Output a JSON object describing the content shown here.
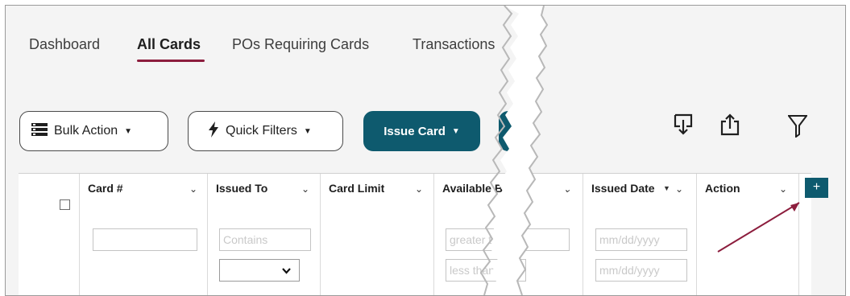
{
  "tabs": [
    {
      "label": "Dashboard",
      "active": false
    },
    {
      "label": "All Cards",
      "active": true
    },
    {
      "label": "POs Requiring Cards",
      "active": false
    },
    {
      "label": "Transactions",
      "active": false
    }
  ],
  "toolbar": {
    "bulk_action": "Bulk Action",
    "quick_filters": "Quick Filters",
    "issue_card": "Issue Card",
    "icons": [
      "download-icon",
      "share-icon",
      "filter-icon"
    ]
  },
  "grid": {
    "columns": [
      {
        "label": "Card #"
      },
      {
        "label": "Issued To"
      },
      {
        "label": "Card Limit"
      },
      {
        "label": "Available Bal"
      },
      {
        "label": "Issued Date"
      },
      {
        "label": "Action"
      }
    ],
    "filters": {
      "issued_to_placeholder": "Contains",
      "available_from_placeholder": "greater t",
      "available_to_placeholder": "less than",
      "issued_date_from_placeholder": "mm/dd/yyyy",
      "issued_date_to_placeholder": "mm/dd/yyyy"
    },
    "add_column_label": "+"
  },
  "colors": {
    "accent_underline": "#8c1d3d",
    "primary_button": "#0e5a6e",
    "arrow": "#8c1d3d"
  }
}
